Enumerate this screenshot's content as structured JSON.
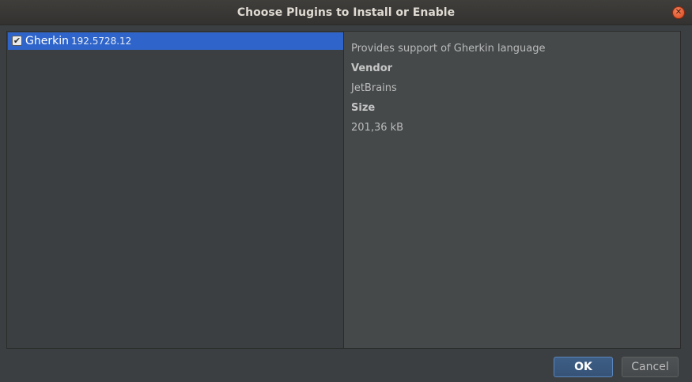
{
  "window": {
    "title": "Choose Plugins to Install or Enable"
  },
  "plugins": [
    {
      "name": "Gherkin",
      "version": "192.5728.12",
      "checked": true
    }
  ],
  "details": {
    "description": "Provides support of Gherkin language",
    "vendor_label": "Vendor",
    "vendor": "JetBrains",
    "size_label": "Size",
    "size": "201,36 kB"
  },
  "buttons": {
    "ok": "OK",
    "cancel": "Cancel"
  },
  "icons": {
    "close": "close-icon",
    "checkbox": "checkmark-icon"
  }
}
